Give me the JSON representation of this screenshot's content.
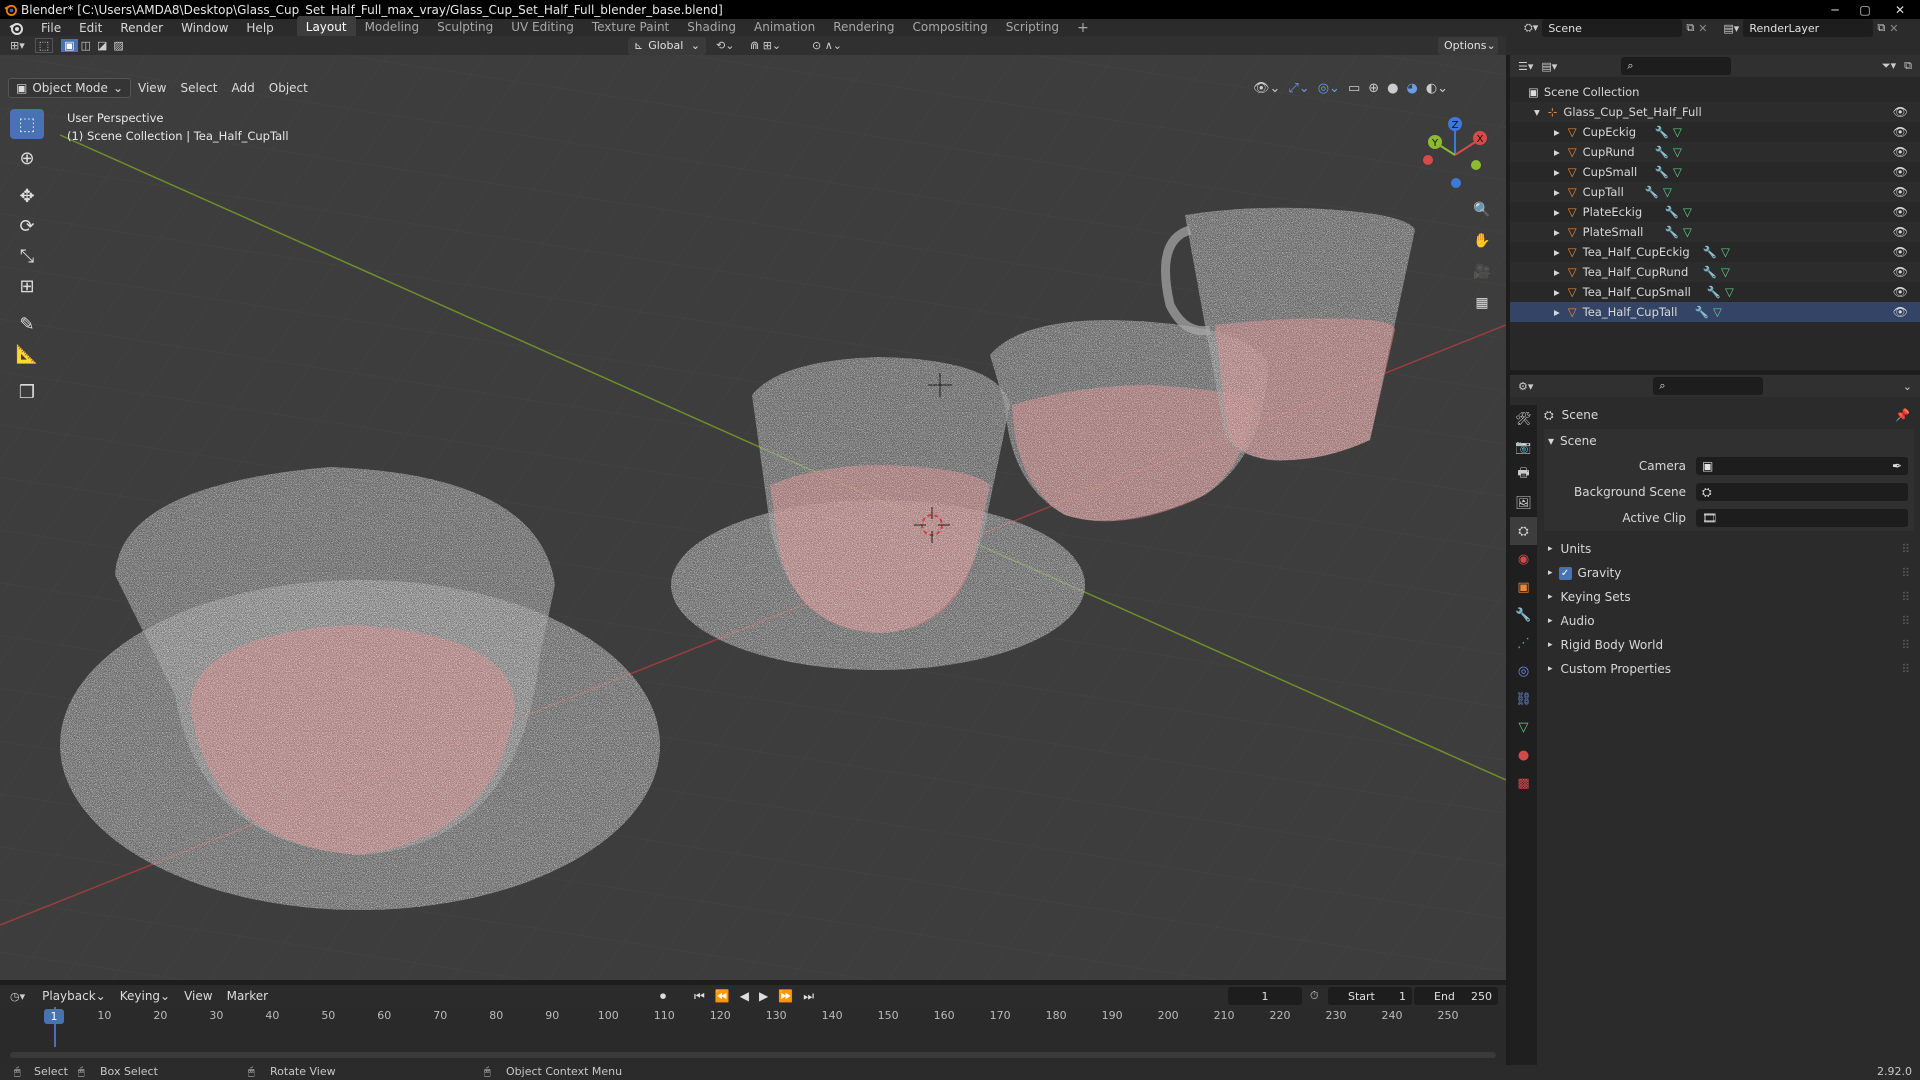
{
  "window": {
    "title": "Blender* [C:\\Users\\AMDA8\\Desktop\\Glass_Cup_Set_Half_Full_max_vray/Glass_Cup_Set_Half_Full_blender_base.blend]",
    "minimize": "─",
    "maximize": "▢",
    "close": "✕"
  },
  "menu": [
    "File",
    "Edit",
    "Render",
    "Window",
    "Help"
  ],
  "workspaces": [
    "Layout",
    "Modeling",
    "Sculpting",
    "UV Editing",
    "Texture Paint",
    "Shading",
    "Animation",
    "Rendering",
    "Compositing",
    "Scripting"
  ],
  "add_workspace": "+",
  "scene_field": "Scene",
  "renderlayer_field": "RenderLayer",
  "header": {
    "transform_orientation": "Global",
    "options": "Options"
  },
  "viewport_menu": {
    "mode": "Object Mode",
    "items": [
      "View",
      "Select",
      "Add",
      "Object"
    ]
  },
  "viewport_overlay": {
    "perspective": "User Perspective",
    "collection": "(1) Scene Collection | Tea_Half_CupTall"
  },
  "gizmo": {
    "x": "X",
    "y": "Y",
    "z": "Z"
  },
  "outliner": {
    "root": "Scene Collection",
    "collection": "Glass_Cup_Set_Half_Full",
    "objects": [
      "CupEckig",
      "CupRund",
      "CupSmall",
      "CupTall",
      "PlateEckig",
      "PlateSmall",
      "Tea_Half_CupEckig",
      "Tea_Half_CupRund",
      "Tea_Half_CupSmall",
      "Tea_Half_CupTall"
    ]
  },
  "properties": {
    "breadcrumb": "Scene",
    "panel": "Scene",
    "camera_label": "Camera",
    "bg_scene_label": "Background Scene",
    "active_clip_label": "Active Clip",
    "subpanels": [
      "Units",
      "Gravity",
      "Keying Sets",
      "Audio",
      "Rigid Body World",
      "Custom Properties"
    ],
    "gravity_checked": true
  },
  "timeline": {
    "menus": [
      "Playback",
      "Keying",
      "View",
      "Marker"
    ],
    "current_frame": "1",
    "start_label": "Start",
    "start": "1",
    "end_label": "End",
    "end": "250",
    "ticks": [
      "1",
      "10",
      "20",
      "30",
      "40",
      "50",
      "60",
      "70",
      "80",
      "90",
      "100",
      "110",
      "120",
      "130",
      "140",
      "150",
      "160",
      "170",
      "180",
      "190",
      "200",
      "210",
      "220",
      "230",
      "240",
      "250"
    ]
  },
  "status": {
    "select": "Select",
    "box_select": "Box Select",
    "rotate_view": "Rotate View",
    "context_menu": "Object Context Menu",
    "version": "2.92.0"
  },
  "colors": {
    "accent": "#4772b3",
    "object_orange": "#e8883a",
    "axis_red": "#b43c3c",
    "axis_green": "#7aa32e"
  }
}
